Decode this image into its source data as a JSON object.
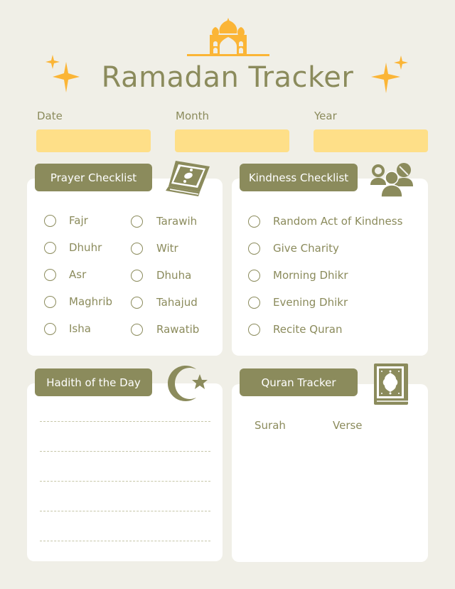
{
  "header": {
    "title": "Ramadan Tracker",
    "icons": [
      "mosque-icon",
      "sparkle-icon",
      "sparkle-icon"
    ]
  },
  "colors": {
    "background": "#f0efe7",
    "accent_olive": "#8b8b5c",
    "accent_gold": "#fbb536",
    "field_yellow": "#fedf88",
    "card": "#ffffff"
  },
  "date_fields": [
    {
      "label": "Date",
      "value": ""
    },
    {
      "label": "Month",
      "value": ""
    },
    {
      "label": "Year",
      "value": ""
    }
  ],
  "prayer_checklist": {
    "title": "Prayer Checklist",
    "icon": "book-icon",
    "column_1": [
      "Fajr",
      "Dhuhr",
      "Asr",
      "Maghrib",
      "Isha"
    ],
    "column_2": [
      "Tarawih",
      "Witr",
      "Dhuha",
      "Tahajud",
      "Rawatib"
    ]
  },
  "kindness_checklist": {
    "title": "Kindness Checklist",
    "icon": "people-icon",
    "items": [
      "Random Act of Kindness",
      "Give Charity",
      "Morning Dhikr",
      "Evening Dhikr",
      "Recite Quran"
    ]
  },
  "hadith": {
    "title": "Hadith of the Day",
    "icon": "crescent-star-icon",
    "line_count": 5
  },
  "quran_tracker": {
    "title": "Quran Tracker",
    "icon": "quran-icon",
    "surah_label": "Surah",
    "verse_label": "Verse"
  }
}
